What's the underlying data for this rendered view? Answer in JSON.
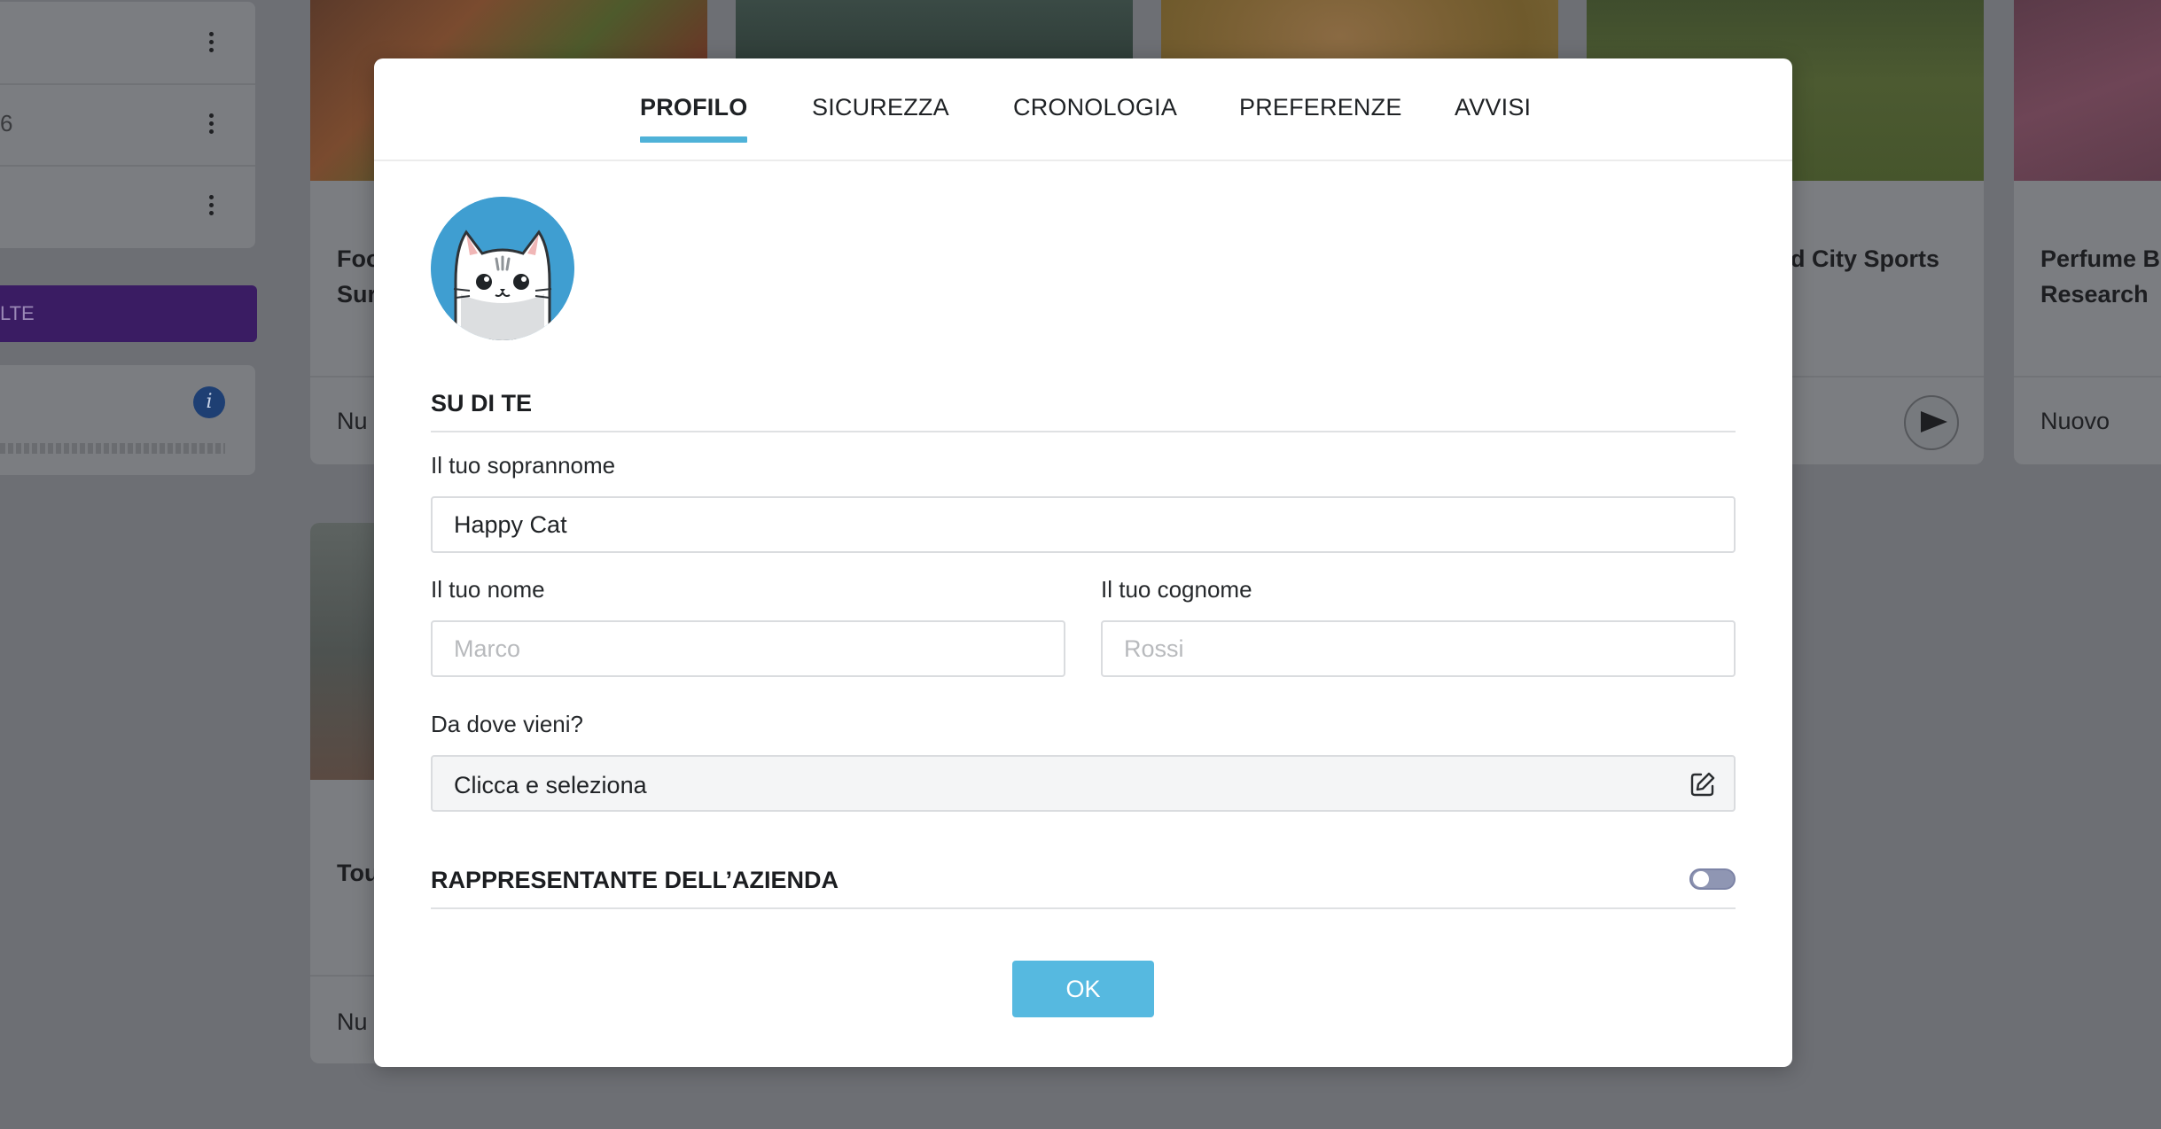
{
  "background": {
    "side_rows": [
      {
        "text": ""
      },
      {
        "text": "6"
      },
      {
        "text": ""
      }
    ],
    "side_button_label": "LTE",
    "info_badge": "i",
    "cards": [
      {
        "title": "Foo\nSur",
        "status": "Nu",
        "image": "food-photo"
      },
      {
        "title": "",
        "status": "",
        "image": "bikes-photo"
      },
      {
        "title": "",
        "status": "",
        "image": "dog-photo"
      },
      {
        "title": "d City Sports",
        "status": "",
        "image": "soccer-photo"
      },
      {
        "title": "Perfume Br\nResearch",
        "status": "Nuovo",
        "image": "perfume-photo"
      }
    ],
    "lower_card": {
      "title": "Tou",
      "status": "Nu"
    }
  },
  "modal": {
    "tabs": [
      {
        "label": "PROFILO",
        "active": true
      },
      {
        "label": "SICUREZZA",
        "active": false
      },
      {
        "label": "CRONOLOGIA",
        "active": false
      },
      {
        "label": "PREFERENZE",
        "active": false
      },
      {
        "label": "AVVISI",
        "active": false
      }
    ],
    "about_section_title": "SU DI TE",
    "nickname": {
      "label": "Il tuo soprannome",
      "value": "Happy Cat"
    },
    "first_name": {
      "label": "Il tuo nome",
      "placeholder": "Marco"
    },
    "last_name": {
      "label": "Il tuo cognome",
      "placeholder": "Rossi"
    },
    "origin": {
      "label": "Da dove vieni?",
      "value": "Clicca e seleziona"
    },
    "company_rep": {
      "label": "RAPPRESENTANTE DELL’AZIENDA",
      "enabled": false
    },
    "ok_label": "OK"
  },
  "colors": {
    "accent": "#4fb2d8",
    "ok_button": "#56b9e0",
    "toggle_off": "#8f96b3",
    "avatar_bg": "#3f9ed1"
  }
}
